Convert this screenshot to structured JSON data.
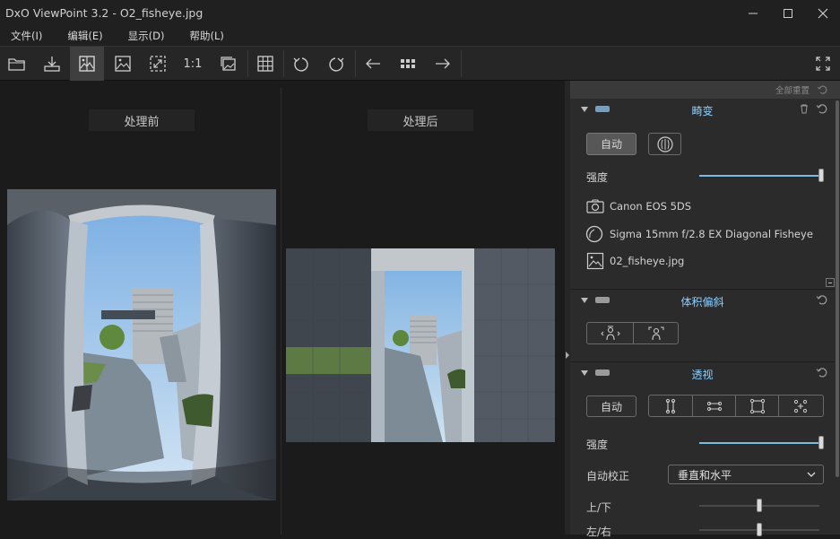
{
  "window": {
    "title": "DxO ViewPoint 3.2 - O2_fisheye.jpg"
  },
  "menu": [
    "文件(I)",
    "编辑(E)",
    "显示(D)",
    "帮助(L)"
  ],
  "toolbar": {
    "zoom_1_1": "1:1"
  },
  "viewer": {
    "before_label": "处理前",
    "after_label": "处理后"
  },
  "panel": {
    "reset_all": "全部重置",
    "distortion": {
      "title": "畸变",
      "auto_button": "自动",
      "intensity_label": "强度",
      "intensity": 1.0,
      "camera": "Canon EOS 5DS",
      "lens": "Sigma 15mm f/2.8 EX Diagonal Fisheye",
      "file": "02_fisheye.jpg"
    },
    "volume": {
      "title": "体积偏斜"
    },
    "perspective": {
      "title": "透视",
      "auto_button": "自动",
      "intensity_label": "强度",
      "intensity": 1.0,
      "auto_correct_label": "自动校正",
      "auto_correct_value": "垂直和水平",
      "vertical_label": "上/下",
      "horizontal_label": "左/右"
    }
  },
  "colors": {
    "accent": "#8fd0ff",
    "slider": "#7cbbe0"
  }
}
